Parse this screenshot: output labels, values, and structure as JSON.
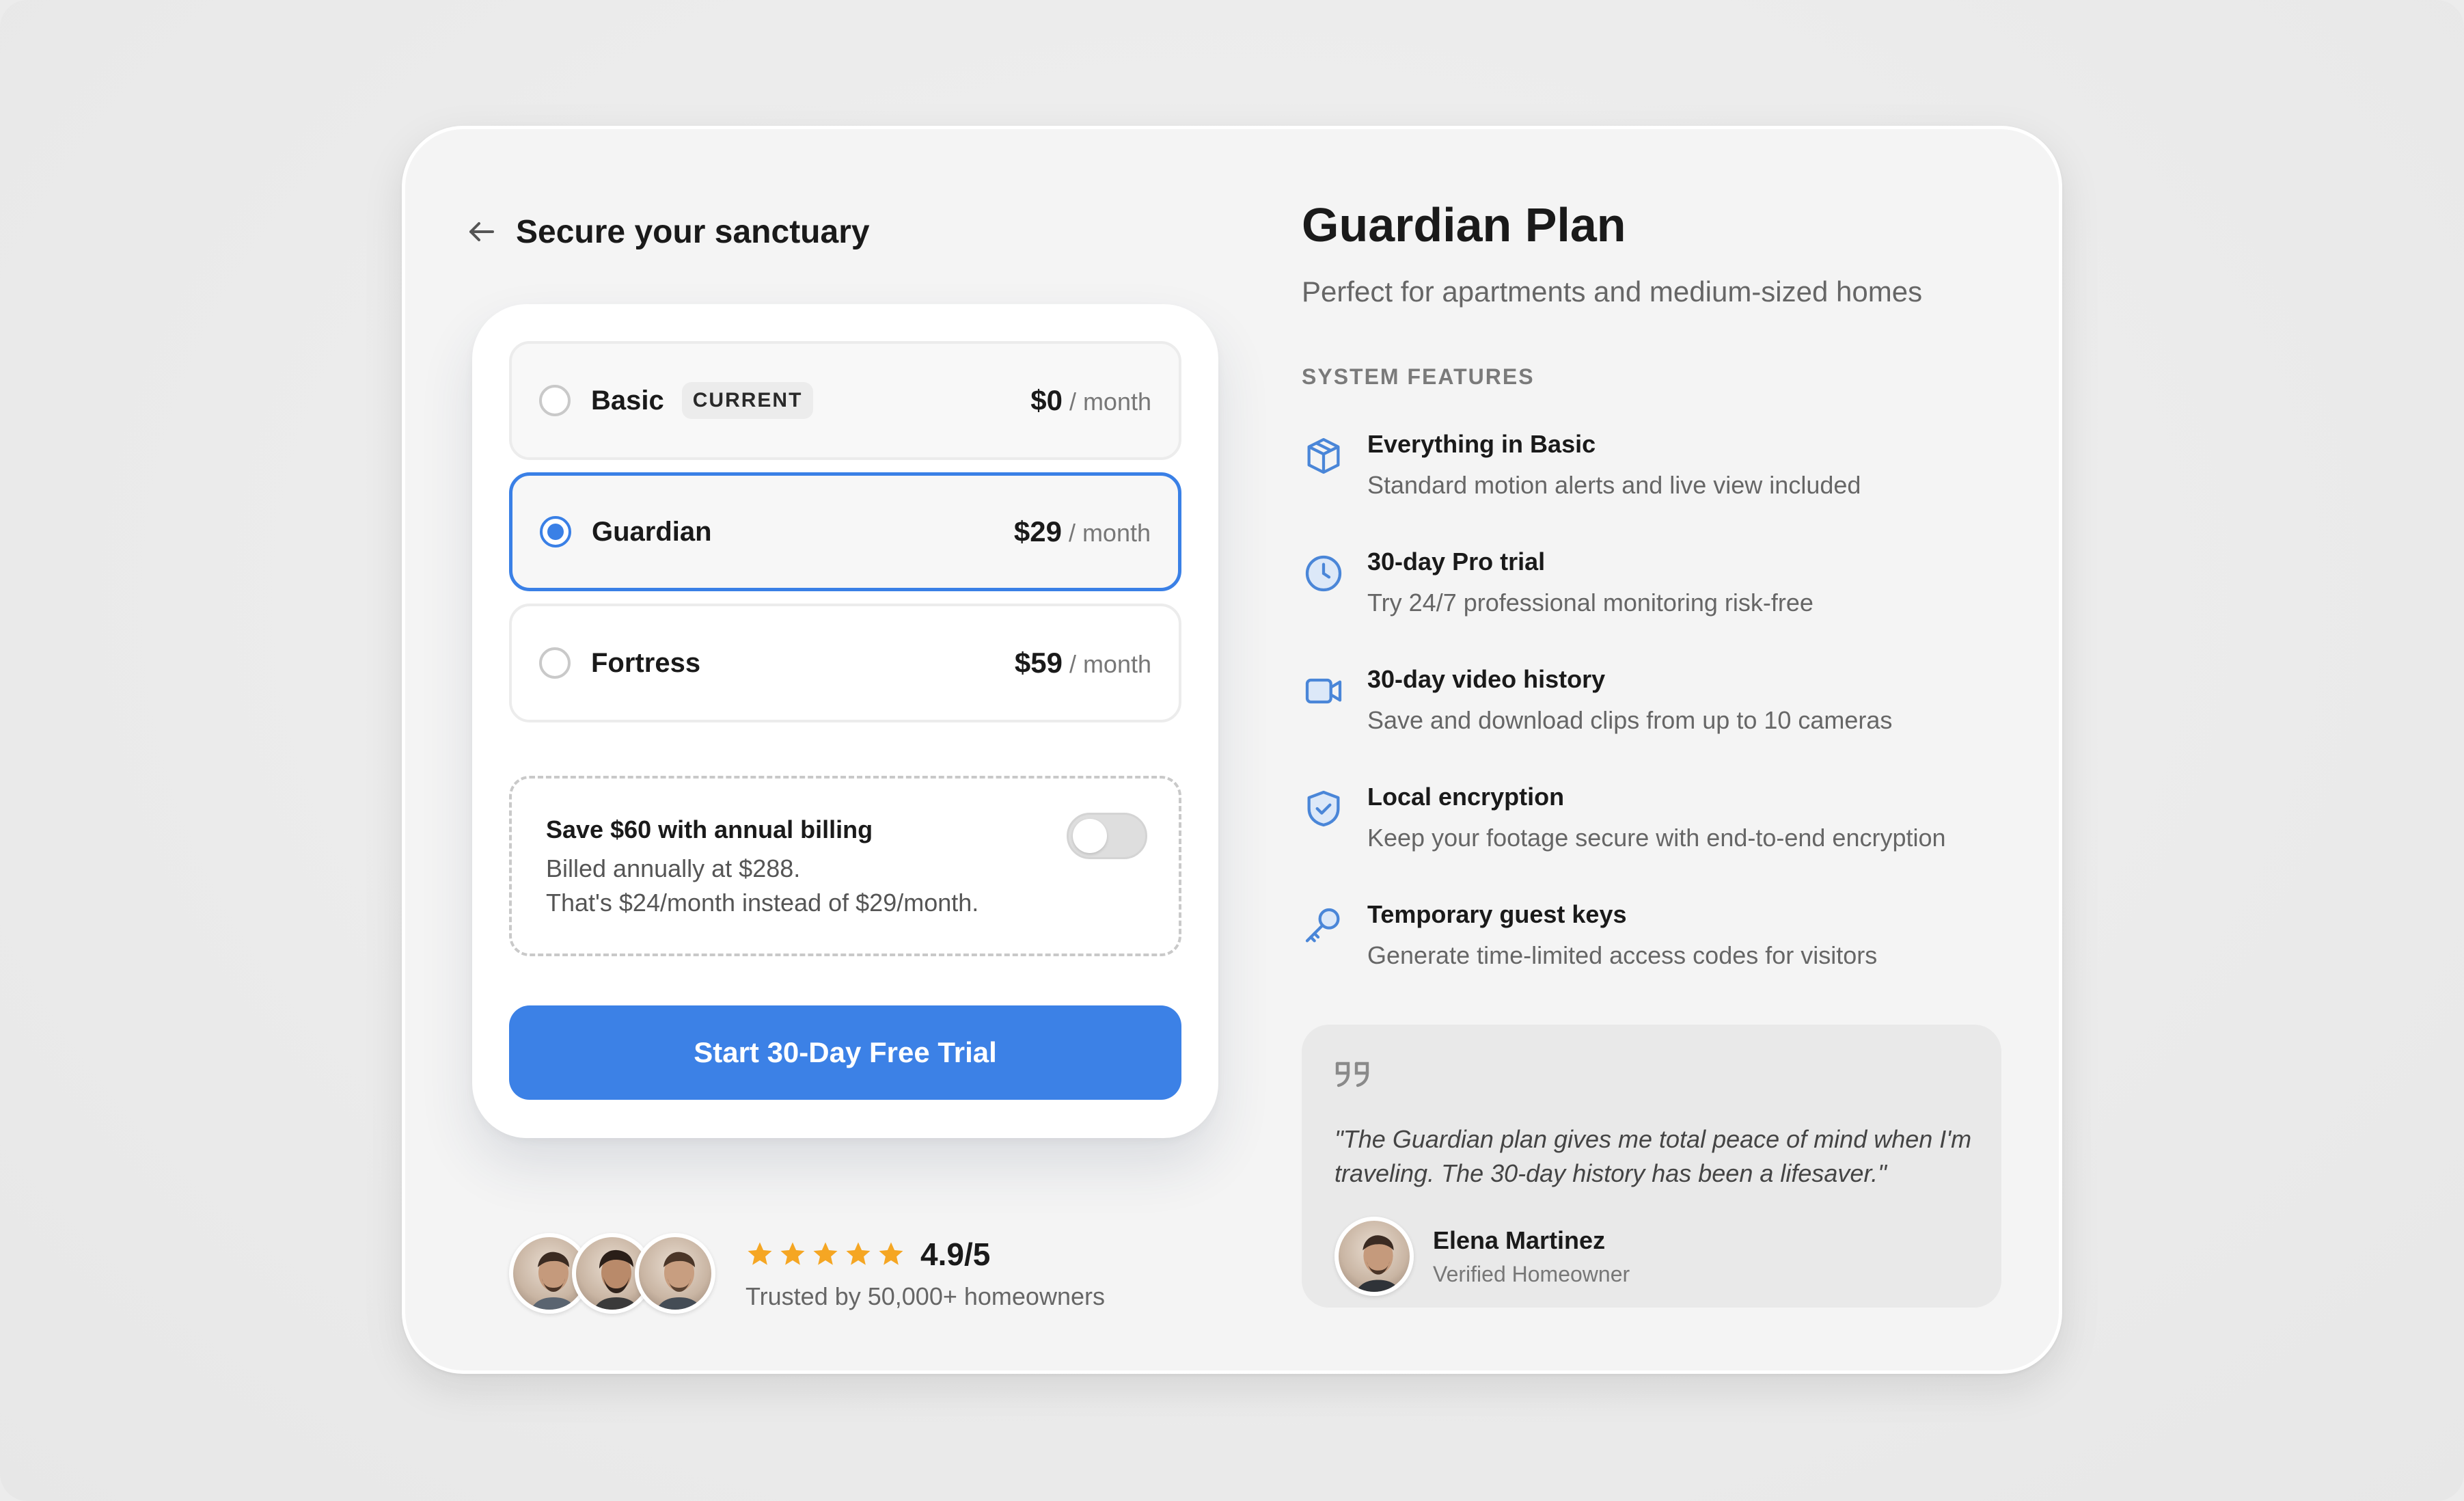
{
  "header": {
    "title": "Secure your sanctuary"
  },
  "plans": [
    {
      "name": "Basic",
      "badge": "CURRENT",
      "price": "$0",
      "unit": "/ month",
      "selected": false
    },
    {
      "name": "Guardian",
      "price": "$29",
      "unit": "/ month",
      "selected": true
    },
    {
      "name": "Fortress",
      "price": "$59",
      "unit": "/ month",
      "selected": false
    }
  ],
  "annual": {
    "title": "Save $60 with annual billing",
    "line1": "Billed annually at $288.",
    "line2": "That's $24/month instead of $29/month.",
    "toggle_on": false
  },
  "cta": {
    "label": "Start 30-Day Free Trial"
  },
  "social": {
    "rating": "4.9/5",
    "stars": 5,
    "trusted": "Trusted by 50,000+ homeowners"
  },
  "detail": {
    "title": "Guardian Plan",
    "subtitle": "Perfect for apartments and medium-sized homes",
    "features_label": "SYSTEM FEATURES",
    "features": [
      {
        "icon": "box-icon",
        "title": "Everything in Basic",
        "desc": "Standard motion alerts and live view included"
      },
      {
        "icon": "clock-icon",
        "title": "30-day Pro trial",
        "desc": "Try 24/7 professional monitoring risk-free"
      },
      {
        "icon": "video-camera-icon",
        "title": "30-day video history",
        "desc": "Save and download clips from up to 10 cameras"
      },
      {
        "icon": "shield-check-icon",
        "title": "Local encryption",
        "desc": "Keep your footage secure with end-to-end encryption"
      },
      {
        "icon": "key-icon",
        "title": "Temporary guest keys",
        "desc": "Generate time-limited access codes for visitors"
      }
    ]
  },
  "testimonial": {
    "text": "\"The Guardian plan gives me total peace of mind when I'm traveling. The 30-day history has been a lifesaver.\"",
    "author": "Elena Martinez",
    "role": "Verified Homeowner"
  },
  "colors": {
    "accent": "#3c81e6",
    "star": "#f5a623",
    "feature_icon": "#4a86d8"
  }
}
